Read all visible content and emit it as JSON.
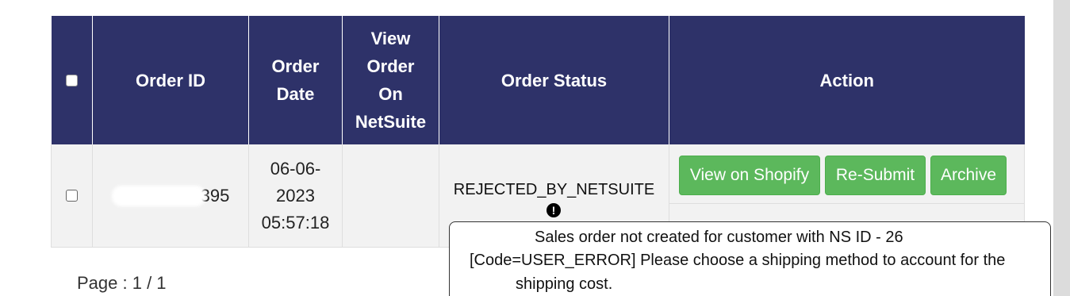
{
  "table": {
    "headers": {
      "order_id": "Order ID",
      "order_date_line1": "Order",
      "order_date_line2": "Date",
      "view_line1": "View",
      "view_line2": "Order",
      "view_line3": "On",
      "view_line4": "NetSuite",
      "order_status": "Order Status",
      "action": "Action"
    },
    "rows": [
      {
        "order_id_visible": "395",
        "date_line1": "06-06-",
        "date_line2": "2023",
        "date_line3": "05:57:18",
        "view_on_netsuite": "",
        "status": "REJECTED_BY_NETSUITE",
        "status_icon": "!",
        "actions": {
          "view_shopify": "View on Shopify",
          "resubmit": "Re-Submit",
          "archive": "Archive"
        }
      }
    ]
  },
  "pagination": "Page : 1 / 1",
  "tooltip": {
    "line1": "Sales order not created for customer with NS ID - 26",
    "line2": "[Code=USER_ERROR] Please choose a shipping method to account for the",
    "line3": "shipping cost."
  },
  "colors": {
    "header_bg": "#2e3269",
    "button_bg": "#5cb85c",
    "row_bg": "#f2f2f2"
  }
}
